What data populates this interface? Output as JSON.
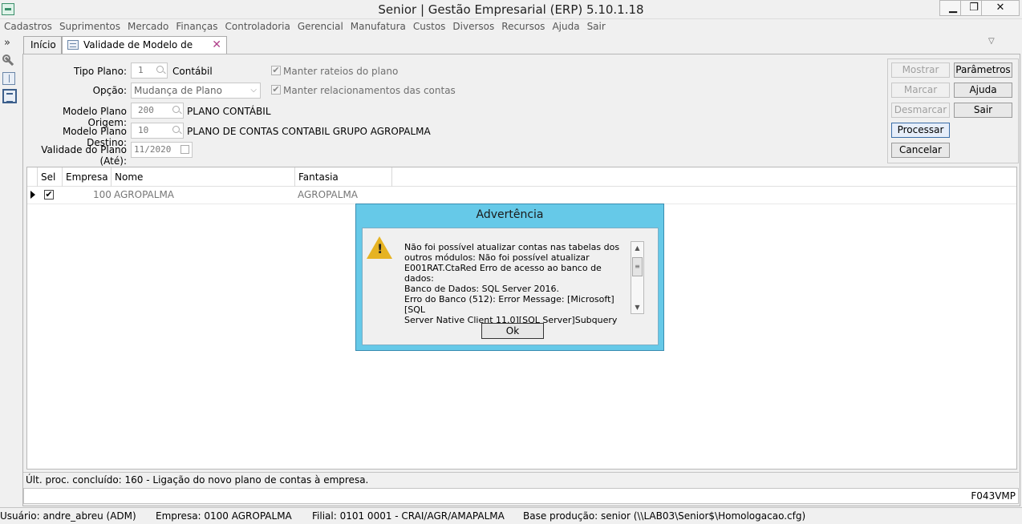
{
  "window": {
    "title": "Senior | Gestão Empresarial (ERP) 5.10.1.18",
    "min": "▁",
    "max": "❐",
    "close": "✕"
  },
  "menu": [
    "Cadastros",
    "Suprimentos",
    "Mercado",
    "Finanças",
    "Controladoria",
    "Gerencial",
    "Manufatura",
    "Custos",
    "Diversos",
    "Recursos",
    "Ajuda",
    "Sair"
  ],
  "left_toolbar": {
    "expand": "»",
    "icons": [
      "wrench-icon",
      "panel-icon",
      "form-icon"
    ]
  },
  "tabs": {
    "home": "Início",
    "active": "Validade de Modelo de Plano",
    "close": "✕",
    "dropdown": "▽"
  },
  "form": {
    "tipo_plano_label": "Tipo Plano:",
    "tipo_plano_value": "1",
    "tipo_plano_desc": "Contábil",
    "opcao_label": "Opção:",
    "opcao_value": "Mudança de Plano",
    "origem_label": "Modelo Plano Origem:",
    "origem_value": "200",
    "origem_desc": "PLANO CONTÁBIL",
    "destino_label": "Modelo Plano Destino:",
    "destino_value": "10",
    "destino_desc": "PLANO DE CONTAS CONTABIL GRUPO AGROPALMA",
    "validade_label": "Validade do Plano (Até):",
    "validade_value": "11/2020",
    "manter_rateios": "Manter rateios do plano",
    "manter_relacionamentos": "Manter relacionamentos das contas"
  },
  "buttons": {
    "mostrar": "Mostrar",
    "parametros": "Parâmetros",
    "marcar": "Marcar",
    "ajuda": "Ajuda",
    "desmarcar": "Desmarcar",
    "sair": "Sair",
    "processar": "Processar",
    "cancelar": "Cancelar"
  },
  "grid": {
    "headers": {
      "sel": "Sel",
      "empresa": "Empresa",
      "nome": "Nome",
      "fantasia": "Fantasia"
    },
    "rows": [
      {
        "checked": "✔",
        "empresa": "100",
        "nome": "AGROPALMA",
        "fantasia": "AGROPALMA"
      }
    ]
  },
  "status": {
    "last_process": "Últ. proc. concluído: 160 - Ligação do novo plano de contas à empresa.",
    "screen_code": "F043VMP"
  },
  "bottom": {
    "usuario": "Usuário: andre_abreu (ADM)",
    "empresa": "Empresa: 0100 AGROPALMA",
    "filial": "Filial: 0101 0001 - CRAI/AGR/AMAPALMA",
    "base": "Base produção: senior (\\\\LAB03\\Senior$\\Homologacao.cfg)"
  },
  "dialog": {
    "title": "Advertência",
    "message": "Não foi possível atualizar contas nas tabelas dos\noutros módulos: Não foi possível atualizar\nE001RAT.CtaRed Erro de acesso ao banco de dados:\nBanco de Dados: SQL Server 2016.\nErro do Banco (512): Error Message: [Microsoft][SQL\nServer Native Client 11.0][SQL Server]Subquery",
    "ok": "Ok"
  }
}
